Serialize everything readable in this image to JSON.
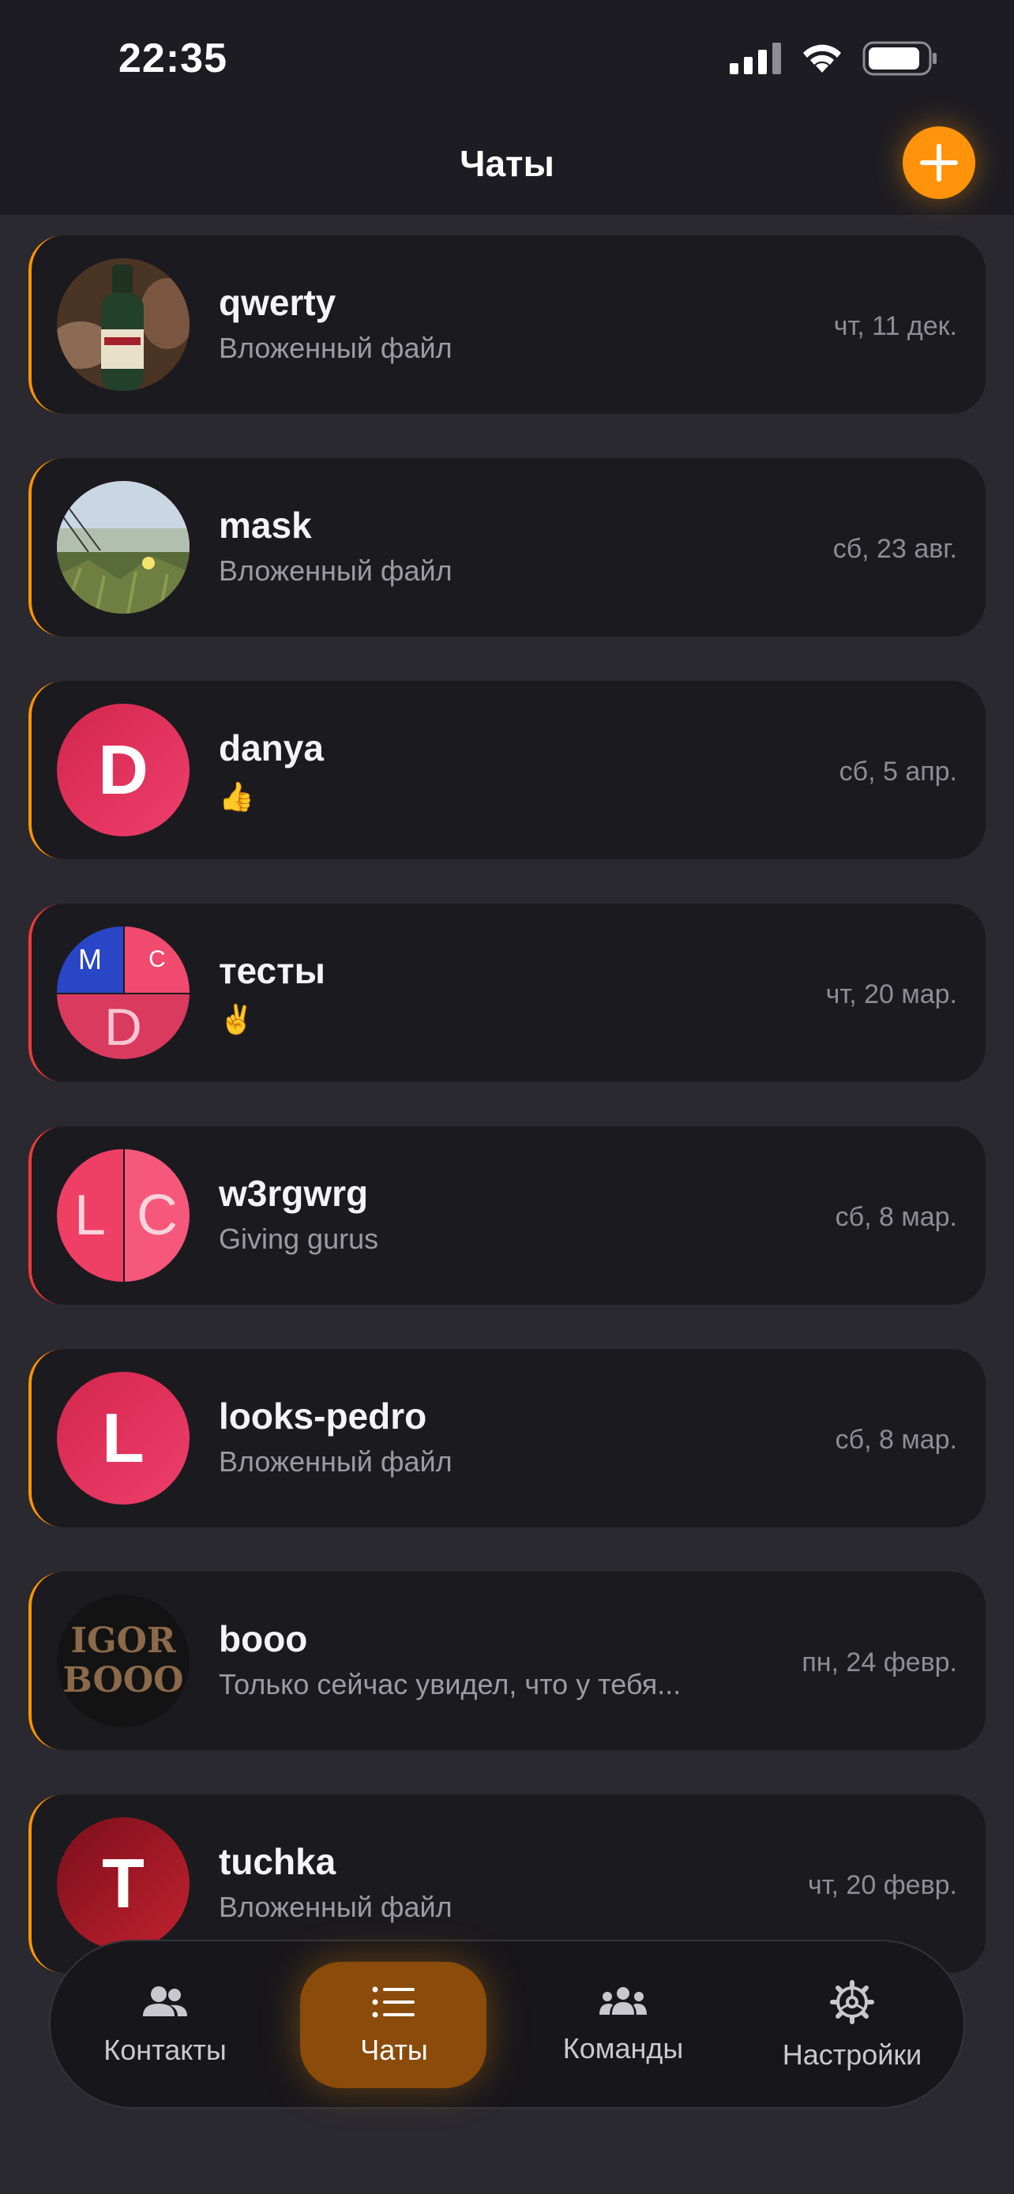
{
  "status": {
    "time": "22:35"
  },
  "header": {
    "title": "Чаты"
  },
  "chats": [
    {
      "name": "qwerty",
      "preview": "Вложенный файл",
      "date": "чт, 11 дек."
    },
    {
      "name": "mask",
      "preview": "Вложенный файл",
      "date": "сб, 23 авг."
    },
    {
      "name": "danya",
      "preview": "👍",
      "date": "сб, 5 апр.",
      "avatar_letter": "D"
    },
    {
      "name": "тесты",
      "preview": "✌️",
      "date": "чт, 20 мар.",
      "avatar_letters": [
        "M",
        "C",
        "D"
      ]
    },
    {
      "name": "w3rgwrg",
      "preview": "Giving gurus",
      "date": "сб, 8 мар.",
      "avatar_letters": [
        "L",
        "C"
      ]
    },
    {
      "name": "looks-pedro",
      "preview": "Вложенный файл",
      "date": "сб, 8 мар.",
      "avatar_letter": "L"
    },
    {
      "name": "booo",
      "preview": "Только сейчас увидел, что у тебя...",
      "date": "пн, 24 февр.",
      "avatar_text": [
        "IGOR",
        "BOOO"
      ]
    },
    {
      "name": "tuchka",
      "preview": "Вложенный файл",
      "date": "чт, 20 февр.",
      "avatar_letter": "T"
    }
  ],
  "tabbar": {
    "items": [
      {
        "label": "Контакты",
        "icon": "contacts-icon"
      },
      {
        "label": "Чаты",
        "icon": "chats-list-icon",
        "active": true
      },
      {
        "label": "Команды",
        "icon": "teams-icon"
      },
      {
        "label": "Настройки",
        "icon": "settings-gear-icon"
      }
    ]
  },
  "colors": {
    "accent": "#ff940a",
    "background": "#2a2930",
    "card": "#1b1a1f",
    "red_accent": "#ef3b3b"
  }
}
